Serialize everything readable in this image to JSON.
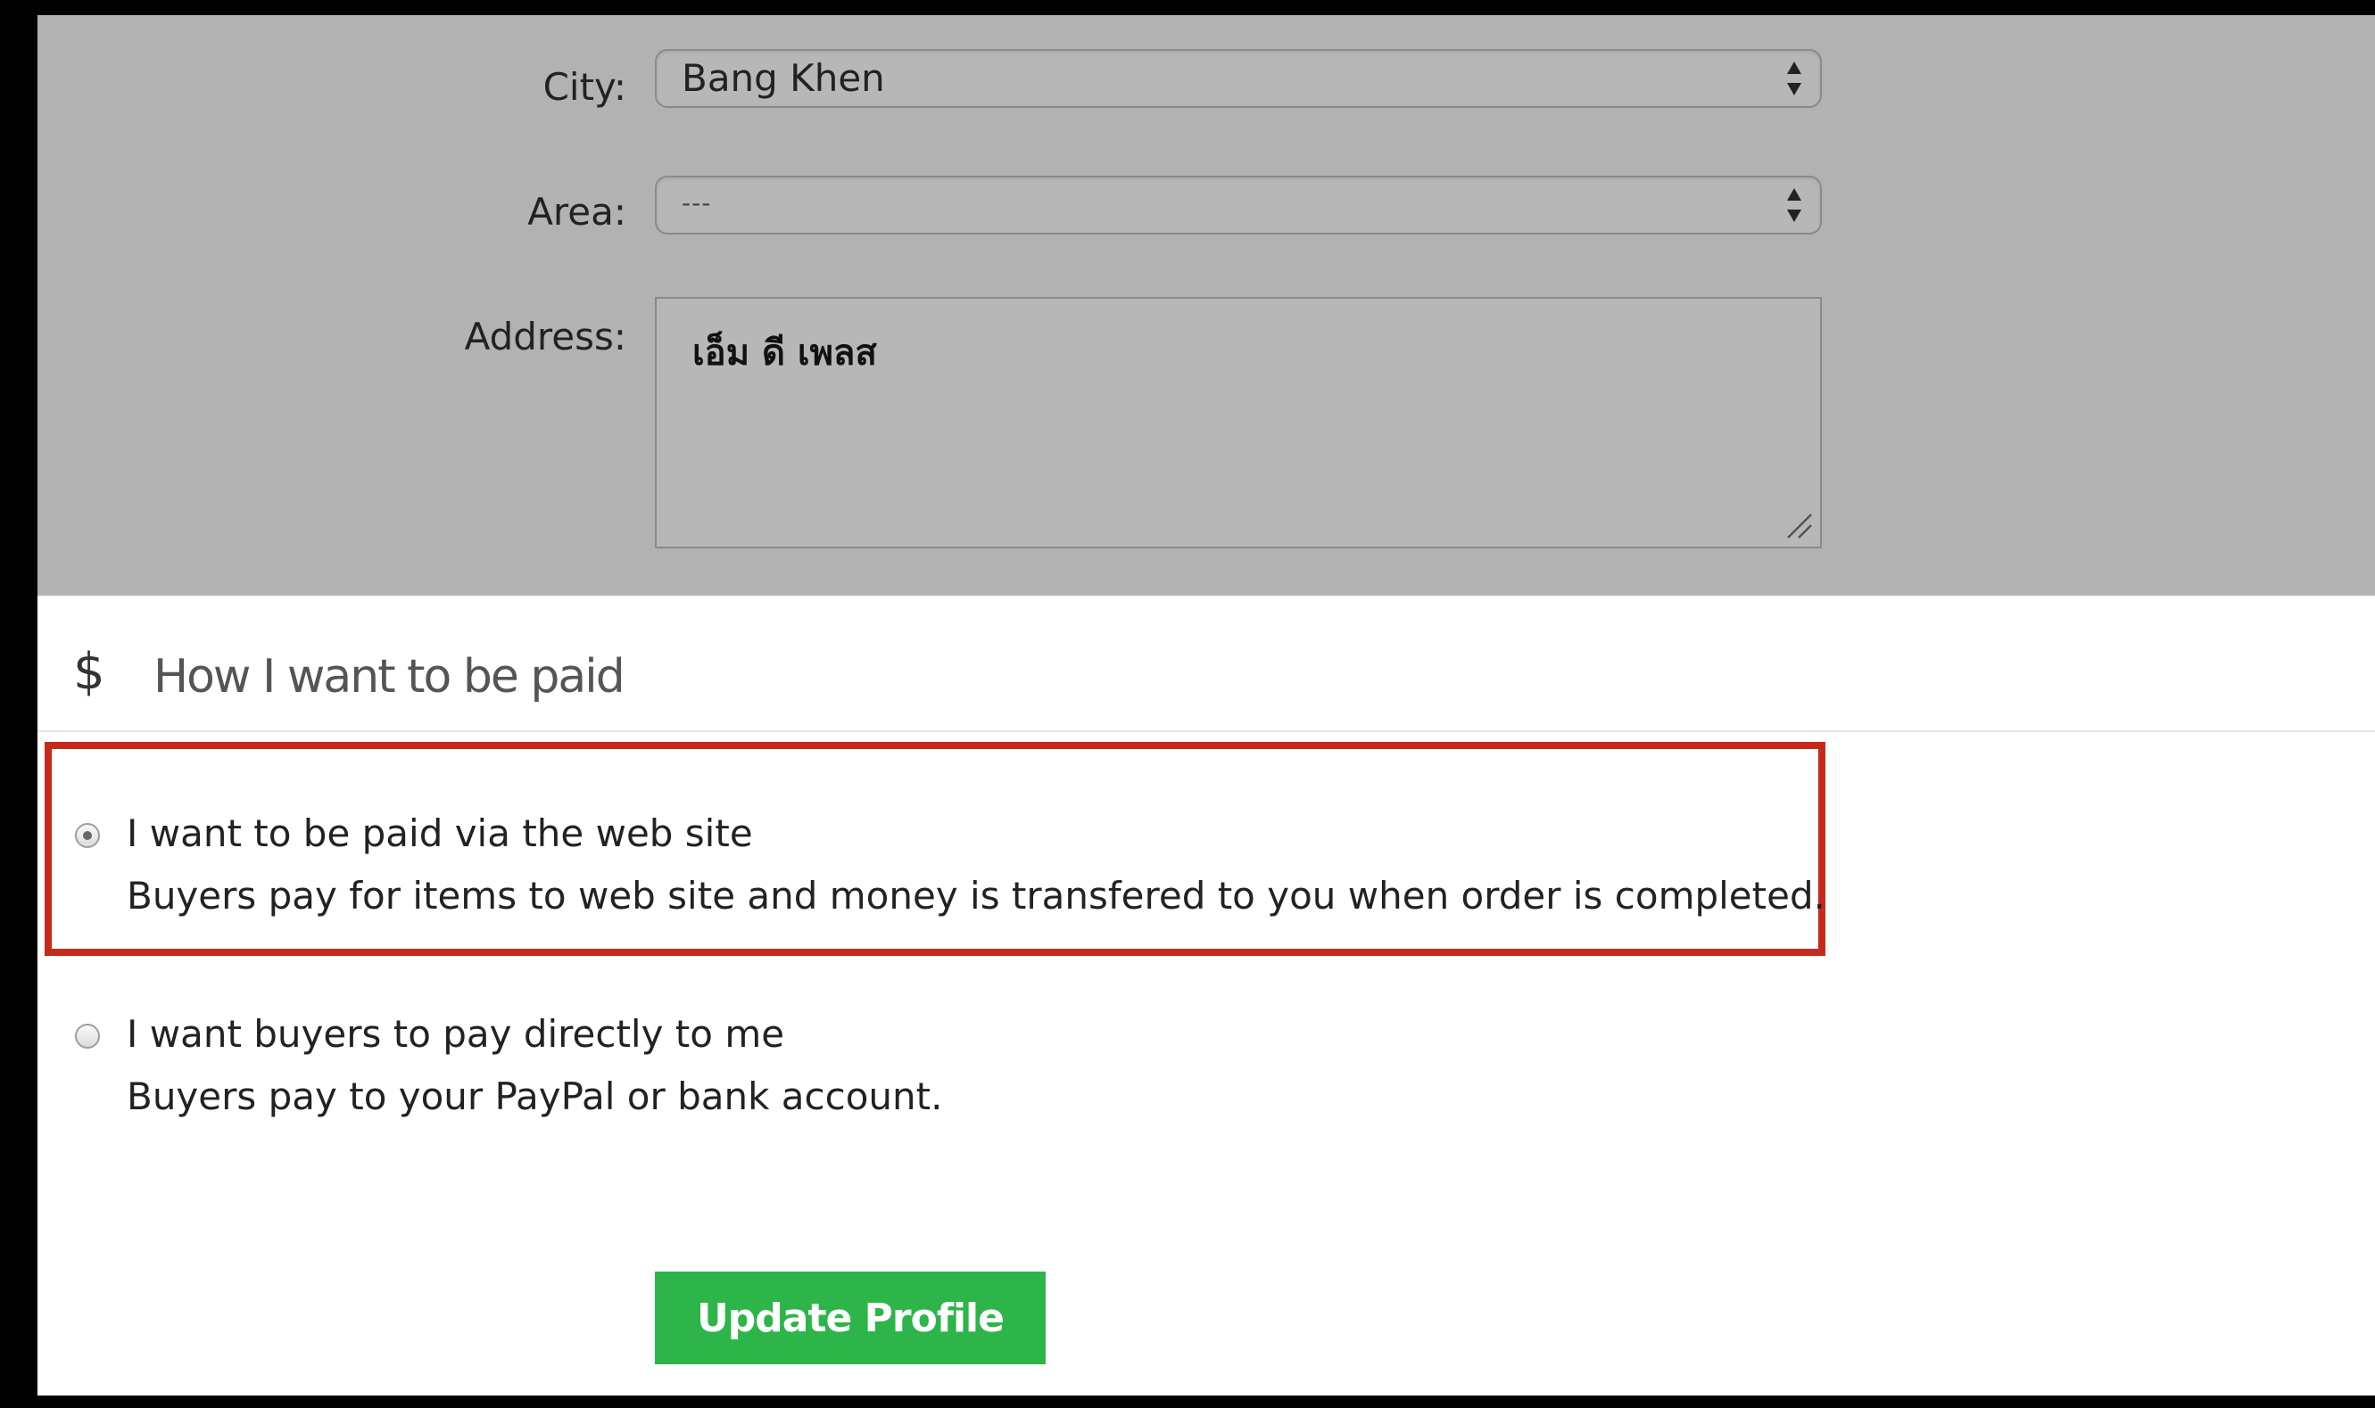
{
  "form": {
    "city_label": "City:",
    "city_value": "Bang Khen",
    "area_label": "Area:",
    "area_value": "---",
    "address_label": "Address:",
    "address_value": "เอ็ม ดี เพลส"
  },
  "payment": {
    "section_icon": "dollar-icon",
    "section_title": "How I want to be paid",
    "options": [
      {
        "title": "I want to be paid via the web site",
        "description": "Buyers pay for items to web site and money is transfered to you when order is completed.",
        "selected": true
      },
      {
        "title": "I want buyers to pay directly to me",
        "description": "Buyers pay to your PayPal or bank account.",
        "selected": false
      }
    ]
  },
  "actions": {
    "update_label": "Update Profile"
  },
  "colors": {
    "highlight": "#c52a1a",
    "button": "#2db54a",
    "panel": "#b2b2b2"
  }
}
